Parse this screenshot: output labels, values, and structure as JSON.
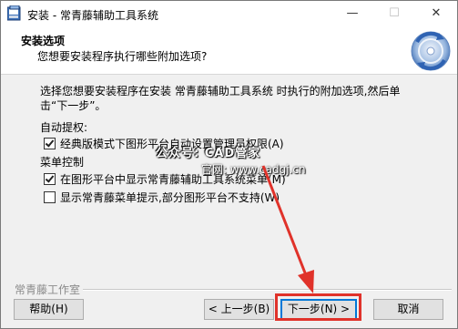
{
  "window": {
    "title": "安装 - 常青藤辅助工具系统",
    "controls": {
      "minimize": "—",
      "maximize": "☐",
      "close": "✕"
    }
  },
  "header": {
    "title": "安装选项",
    "subtitle": "您想要安装程序执行哪些附加选项?",
    "icon": "setup-disc-icon"
  },
  "main": {
    "description": "选择您想要安装程序在安装 常青藤辅助工具系统 时执行的附加选项,然后单击“下一步”。",
    "groups": [
      {
        "label": "自动提权:",
        "options": [
          {
            "label": "经典版模式下图形平台自动设置管理员权限(A)",
            "checked": true
          }
        ]
      },
      {
        "label": "菜单控制",
        "options": [
          {
            "label": "在图形平台中显示常青藤辅助工具系统菜单(M)",
            "checked": true
          },
          {
            "label": "显示常青藤菜单提示,部分图形平台不支持(W)",
            "checked": false
          }
        ]
      }
    ]
  },
  "watermark": {
    "line1": "公众号: CAD管家",
    "line2": "官网: www.cadgj.cn"
  },
  "footer": {
    "studio": "常青藤工作室",
    "help_label": "帮助(H)",
    "back_label": "< 上一步(B)",
    "next_label": "下一步(N) >",
    "cancel_label": "取消"
  },
  "annotation": {
    "color": "#e0322a",
    "target": "next-button"
  }
}
